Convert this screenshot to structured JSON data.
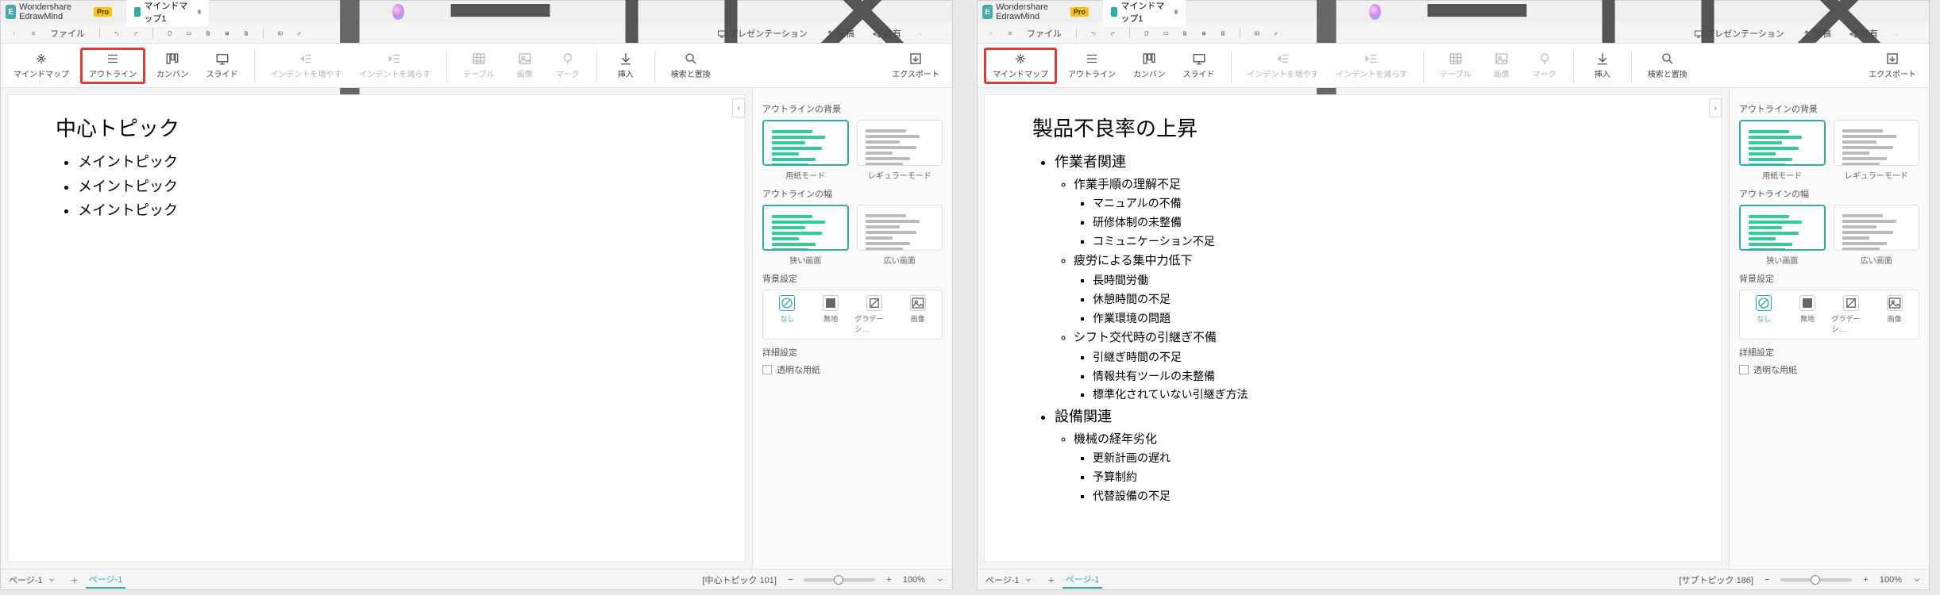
{
  "apps": [
    {
      "title": "Wondershare EdrawMind",
      "pro": "Pro",
      "tab": "マインドマップ1",
      "menu": {
        "file": "ファイル",
        "presentation": "プレゼンテーション",
        "post": "投稿",
        "share": "共有"
      },
      "ribbon": {
        "mindmap": "マインドマップ",
        "outline": "アウトライン",
        "kanban": "カンバン",
        "slide": "スライド",
        "indent_inc": "インデントを増やす",
        "indent_dec": "インデントを減らす",
        "table": "テーブル",
        "image": "画像",
        "mark": "マーク",
        "insert": "挿入",
        "find": "検索と置換",
        "export": "エクスポート",
        "highlighted": "outline"
      },
      "doc": {
        "title": "中心トピック",
        "layout": "flat",
        "items": [
          "メイントピック",
          "メイントピック",
          "メイントピック"
        ]
      },
      "panel": {
        "bg_title": "アウトラインの背景",
        "paper_mode": "用紙モード",
        "regular_mode": "レギュラーモード",
        "width_title": "アウトラインの幅",
        "narrow": "狭い画面",
        "wide": "広い画面",
        "bgset_title": "背景設定",
        "none": "なし",
        "solid": "無地",
        "grad": "グラデーシ…",
        "img": "画像",
        "detail_title": "詳細設定",
        "transparent": "透明な用紙"
      },
      "status": {
        "page": "ページ-1",
        "tab": "ページ-1",
        "info": "[中心トピック 101]",
        "zoom": "100%"
      }
    },
    {
      "title": "Wondershare EdrawMind",
      "pro": "Pro",
      "tab": "マインドマップ1",
      "menu": {
        "file": "ファイル",
        "presentation": "プレゼンテーション",
        "post": "投稿",
        "share": "共有"
      },
      "ribbon": {
        "mindmap": "マインドマップ",
        "outline": "アウトライン",
        "kanban": "カンバン",
        "slide": "スライド",
        "indent_inc": "インデントを増やす",
        "indent_dec": "インデントを減らす",
        "table": "テーブル",
        "image": "画像",
        "mark": "マーク",
        "insert": "挿入",
        "find": "検索と置換",
        "export": "エクスポート",
        "highlighted": "mindmap"
      },
      "doc": {
        "title": "製品不良率の上昇",
        "layout": "tree",
        "nodes": [
          {
            "t": "作業者関連",
            "children": [
              {
                "t": "作業手順の理解不足",
                "children": [
                  {
                    "t": "マニュアルの不備"
                  },
                  {
                    "t": "研修体制の未整備"
                  },
                  {
                    "t": "コミュニケーション不足"
                  }
                ]
              },
              {
                "t": "疲労による集中力低下",
                "children": [
                  {
                    "t": "長時間労働"
                  },
                  {
                    "t": "休憩時間の不足"
                  },
                  {
                    "t": "作業環境の問題"
                  }
                ]
              },
              {
                "t": "シフト交代時の引継ぎ不備",
                "children": [
                  {
                    "t": "引継ぎ時間の不足"
                  },
                  {
                    "t": "情報共有ツールの未整備"
                  },
                  {
                    "t": "標準化されていない引継ぎ方法"
                  }
                ]
              }
            ]
          },
          {
            "t": "設備関連",
            "children": [
              {
                "t": "機械の経年劣化",
                "children": [
                  {
                    "t": "更新計画の遅れ"
                  },
                  {
                    "t": "予算制約"
                  },
                  {
                    "t": "代替設備の不足"
                  }
                ]
              }
            ]
          }
        ]
      },
      "panel": {
        "bg_title": "アウトラインの背景",
        "paper_mode": "用紙モード",
        "regular_mode": "レギュラーモード",
        "width_title": "アウトラインの幅",
        "narrow": "狭い画面",
        "wide": "広い画面",
        "bgset_title": "背景設定",
        "none": "なし",
        "solid": "無地",
        "grad": "グラデーシ…",
        "img": "画像",
        "detail_title": "詳細設定",
        "transparent": "透明な用紙"
      },
      "status": {
        "page": "ページ-1",
        "tab": "ページ-1",
        "info": "[サブトピック 186]",
        "zoom": "100%"
      }
    }
  ]
}
